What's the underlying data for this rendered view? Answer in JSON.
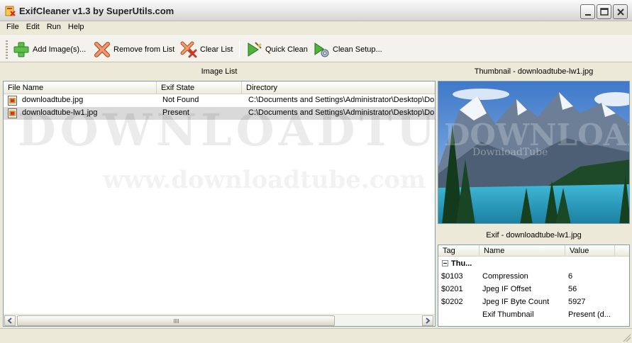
{
  "window": {
    "title": "ExifCleaner v1.3 by SuperUtils.com"
  },
  "menu": [
    "File",
    "Edit",
    "Run",
    "Help"
  ],
  "toolbar": {
    "add": "Add Image(s)...",
    "remove": "Remove from List",
    "clear": "Clear List",
    "quick": "Quick Clean",
    "setup": "Clean Setup..."
  },
  "image_list": {
    "caption": "Image List",
    "columns": [
      "File Name",
      "Exif State",
      "Directory"
    ],
    "rows": [
      {
        "name": "downloadtube.jpg",
        "state": "Not Found",
        "dir": "C:\\Documents and Settings\\Administrator\\Desktop\\Dow"
      },
      {
        "name": "downloadtube-lw1.jpg",
        "state": "Present",
        "dir": "C:\\Documents and Settings\\Administrator\\Desktop\\Dow"
      }
    ]
  },
  "thumbnail": {
    "caption": "Thumbnail - downloadtube-lw1.jpg"
  },
  "exif": {
    "caption": "Exif - downloadtube-lw1.jpg",
    "columns": [
      "Tag",
      "Name",
      "Value"
    ],
    "group": "Thu...",
    "rows": [
      {
        "tag": "$0103",
        "name": "Compression",
        "value": "6"
      },
      {
        "tag": "$0201",
        "name": "Jpeg IF Offset",
        "value": "56"
      },
      {
        "tag": "$0202",
        "name": "Jpeg IF Byte Count",
        "value": "5927"
      },
      {
        "tag": "",
        "name": "Exif Thumbnail",
        "value": "Present (d..."
      }
    ]
  },
  "watermark": {
    "line1": "DOWNLOADTUBE",
    "line2": "www.downloadtube.com",
    "line3": "DownloadTube"
  }
}
